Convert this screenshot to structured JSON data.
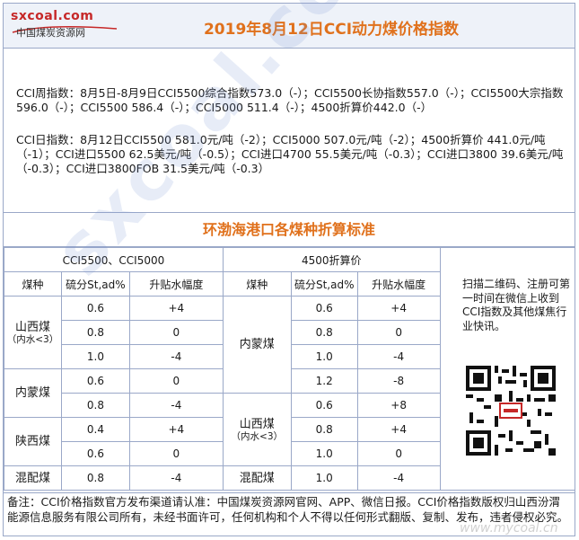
{
  "header": {
    "logo_domain": "sxcoal.com",
    "logo_name": "中国煤炭资源网",
    "title": "2019年8月12日CCI动力煤价格指数"
  },
  "index": {
    "weekly": "CCI周指数：8月5日-8月9日CCI5500综合指数573.0（-）；CCI5500长协指数557.0（-）；CCI5500大宗指数596.0（-）；CCI5500 586.4（-）；CCI5000 511.4（-）；4500折算价442.0（-）",
    "daily": "CCI日指数：8月12日CCI5500 581.0元/吨（-2）；CCI5000 507.0元/吨（-2）；4500折算价 441.0元/吨（-1）；CCI进口5500 62.5美元/吨（-0.5）；CCI进口4700 55.5美元/吨（-0.3）；CCI进口3800 39.6美元/吨（-0.3）；CCI进口3800FOB 31.5美元/吨（-0.3）"
  },
  "section_title": "环渤海港口各煤种折算标准",
  "table": {
    "group_left": "CCI5500、CCI5000",
    "group_right": "4500折算价",
    "col_coal": "煤种",
    "col_sulfur": "硫分St,ad%",
    "col_adjust": "升贴水幅度",
    "left": [
      {
        "coal": "山西煤",
        "sub": "（内水<3）",
        "rows": [
          [
            "0.6",
            "+4"
          ],
          [
            "0.8",
            "0"
          ],
          [
            "1.0",
            "-4"
          ]
        ]
      },
      {
        "coal": "内蒙煤",
        "sub": "",
        "rows": [
          [
            "0.6",
            "0"
          ],
          [
            "0.8",
            "-4"
          ]
        ]
      },
      {
        "coal": "陕西煤",
        "sub": "",
        "rows": [
          [
            "0.4",
            "+4"
          ],
          [
            "0.6",
            "0"
          ]
        ]
      },
      {
        "coal": "混配煤",
        "sub": "",
        "rows": [
          [
            "0.8",
            "-4"
          ]
        ]
      }
    ],
    "right": [
      {
        "coal": "内蒙煤",
        "sub": "",
        "rows": [
          [
            "0.6",
            "+4"
          ],
          [
            "0.8",
            "0"
          ],
          [
            "1.0",
            "-4"
          ],
          [
            "1.2",
            "-8"
          ]
        ]
      },
      {
        "coal": "山西煤",
        "sub": "（内水<3）",
        "rows": [
          [
            "0.6",
            "+8"
          ],
          [
            "0.8",
            "+4"
          ],
          [
            "1.0",
            "0"
          ]
        ]
      },
      {
        "coal": "混配煤",
        "sub": "",
        "rows": [
          [
            "1.0",
            "-4"
          ]
        ]
      }
    ]
  },
  "side_note": "扫描二维码、注册可第一时间在微信上收到CCI指数及其他煤焦行业快讯。",
  "note": "备注：CCI价格指数官方发布渠道请认准：中国煤炭资源网官网、APP、微信日报。CCI价格指数版权归山西汾渭能源信息服务有限公司所有，未经书面许可，任何机构和个人不得以任何形式翻版、复制、发布，违者侵权必究。",
  "watermark": "sxcoal.com",
  "watermark_small": "www.mycoal.cn",
  "colors": {
    "accent": "#e0711c",
    "border": "#9aa8c8",
    "brand_red": "#c62828"
  }
}
